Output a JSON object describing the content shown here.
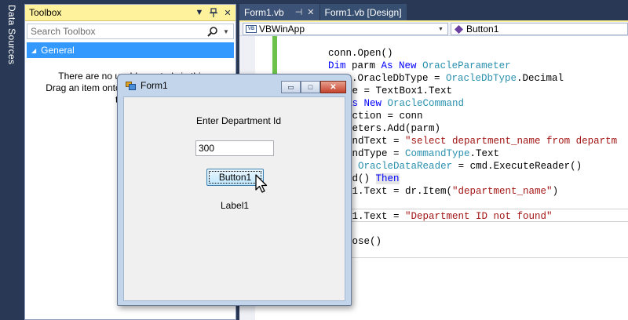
{
  "side_strip": {
    "label": "Data Sources"
  },
  "toolbox": {
    "title": "Toolbox",
    "search_placeholder": "Search Toolbox",
    "group": "General",
    "empty_line1": "There are no usable controls in this",
    "empty_line2": "Drag an item onto this text to add it to the",
    "empty_line3": "toolbox."
  },
  "tabs": [
    {
      "label": "Form1.vb",
      "active": true
    },
    {
      "label": "Form1.vb [Design]",
      "active": false
    }
  ],
  "nav": {
    "project": "VBWinApp",
    "member": "Button1"
  },
  "code_lines": [
    "conn.Open()",
    "Dim parm As New OracleParameter",
    "parm.OracleDbType = OracleDbType.Decimal",
    ".Value = TextBox1.Text",
    "cmd As New OracleCommand",
    "Connection = conn",
    "Parameters.Add(parm)",
    "CommandText = \"select department_name from departm",
    "CommandType = CommandType.Text",
    "dr As OracleDataReader = cmd.ExecuteReader()",
    "r.Read() Then",
    "Label1.Text = dr.Item(\"department_name\")",
    "",
    "Label1.Text = \"Department ID not found\"",
    "If",
    ".Dispose()"
  ],
  "form": {
    "title": "Form1",
    "prompt_label": "Enter Department Id",
    "textbox_value": "300",
    "button_label": "Button1",
    "result_label": "Label1",
    "minimize_glyph": "▭",
    "maximize_glyph": "□",
    "close_glyph": "✕"
  },
  "colors": {
    "ide_background": "#293955",
    "toolbox_title": "#fff29d",
    "selected_group": "#3399ff",
    "keyword": "#0000ff",
    "type": "#2b91af",
    "string": "#a31515"
  }
}
